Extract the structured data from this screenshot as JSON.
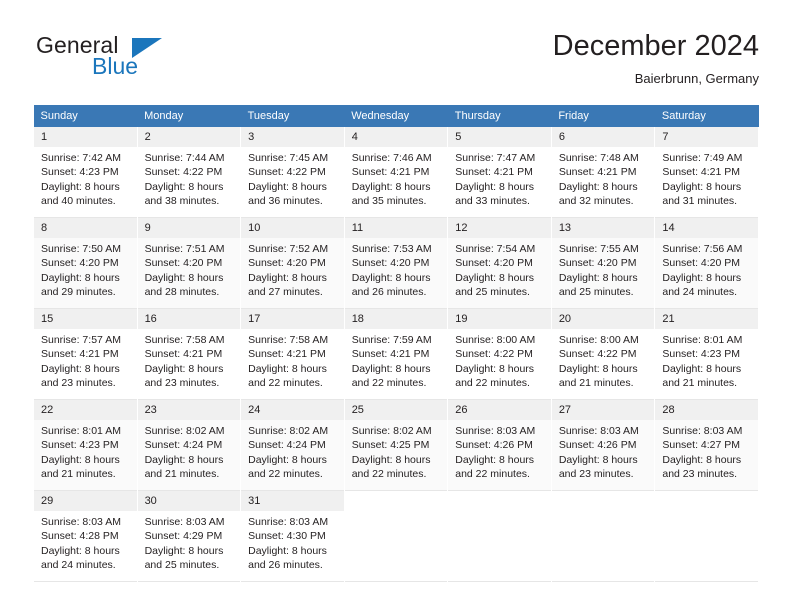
{
  "brand": {
    "name_part1": "General",
    "name_part2": "Blue",
    "triangle_color": "#1b76bc"
  },
  "header": {
    "title": "December 2024",
    "subtitle": "Baierbrunn, Germany",
    "header_bg": "#3a78b5",
    "daynum_bg": "#f0f0f0"
  },
  "calendar": {
    "weekday_headers": [
      "Sunday",
      "Monday",
      "Tuesday",
      "Wednesday",
      "Thursday",
      "Friday",
      "Saturday"
    ],
    "weeks": [
      [
        {
          "day": "1",
          "sunrise": "Sunrise: 7:42 AM",
          "sunset": "Sunset: 4:23 PM",
          "daylight1": "Daylight: 8 hours",
          "daylight2": "and 40 minutes."
        },
        {
          "day": "2",
          "sunrise": "Sunrise: 7:44 AM",
          "sunset": "Sunset: 4:22 PM",
          "daylight1": "Daylight: 8 hours",
          "daylight2": "and 38 minutes."
        },
        {
          "day": "3",
          "sunrise": "Sunrise: 7:45 AM",
          "sunset": "Sunset: 4:22 PM",
          "daylight1": "Daylight: 8 hours",
          "daylight2": "and 36 minutes."
        },
        {
          "day": "4",
          "sunrise": "Sunrise: 7:46 AM",
          "sunset": "Sunset: 4:21 PM",
          "daylight1": "Daylight: 8 hours",
          "daylight2": "and 35 minutes."
        },
        {
          "day": "5",
          "sunrise": "Sunrise: 7:47 AM",
          "sunset": "Sunset: 4:21 PM",
          "daylight1": "Daylight: 8 hours",
          "daylight2": "and 33 minutes."
        },
        {
          "day": "6",
          "sunrise": "Sunrise: 7:48 AM",
          "sunset": "Sunset: 4:21 PM",
          "daylight1": "Daylight: 8 hours",
          "daylight2": "and 32 minutes."
        },
        {
          "day": "7",
          "sunrise": "Sunrise: 7:49 AM",
          "sunset": "Sunset: 4:21 PM",
          "daylight1": "Daylight: 8 hours",
          "daylight2": "and 31 minutes."
        }
      ],
      [
        {
          "day": "8",
          "sunrise": "Sunrise: 7:50 AM",
          "sunset": "Sunset: 4:20 PM",
          "daylight1": "Daylight: 8 hours",
          "daylight2": "and 29 minutes."
        },
        {
          "day": "9",
          "sunrise": "Sunrise: 7:51 AM",
          "sunset": "Sunset: 4:20 PM",
          "daylight1": "Daylight: 8 hours",
          "daylight2": "and 28 minutes."
        },
        {
          "day": "10",
          "sunrise": "Sunrise: 7:52 AM",
          "sunset": "Sunset: 4:20 PM",
          "daylight1": "Daylight: 8 hours",
          "daylight2": "and 27 minutes."
        },
        {
          "day": "11",
          "sunrise": "Sunrise: 7:53 AM",
          "sunset": "Sunset: 4:20 PM",
          "daylight1": "Daylight: 8 hours",
          "daylight2": "and 26 minutes."
        },
        {
          "day": "12",
          "sunrise": "Sunrise: 7:54 AM",
          "sunset": "Sunset: 4:20 PM",
          "daylight1": "Daylight: 8 hours",
          "daylight2": "and 25 minutes."
        },
        {
          "day": "13",
          "sunrise": "Sunrise: 7:55 AM",
          "sunset": "Sunset: 4:20 PM",
          "daylight1": "Daylight: 8 hours",
          "daylight2": "and 25 minutes."
        },
        {
          "day": "14",
          "sunrise": "Sunrise: 7:56 AM",
          "sunset": "Sunset: 4:20 PM",
          "daylight1": "Daylight: 8 hours",
          "daylight2": "and 24 minutes."
        }
      ],
      [
        {
          "day": "15",
          "sunrise": "Sunrise: 7:57 AM",
          "sunset": "Sunset: 4:21 PM",
          "daylight1": "Daylight: 8 hours",
          "daylight2": "and 23 minutes."
        },
        {
          "day": "16",
          "sunrise": "Sunrise: 7:58 AM",
          "sunset": "Sunset: 4:21 PM",
          "daylight1": "Daylight: 8 hours",
          "daylight2": "and 23 minutes."
        },
        {
          "day": "17",
          "sunrise": "Sunrise: 7:58 AM",
          "sunset": "Sunset: 4:21 PM",
          "daylight1": "Daylight: 8 hours",
          "daylight2": "and 22 minutes."
        },
        {
          "day": "18",
          "sunrise": "Sunrise: 7:59 AM",
          "sunset": "Sunset: 4:21 PM",
          "daylight1": "Daylight: 8 hours",
          "daylight2": "and 22 minutes."
        },
        {
          "day": "19",
          "sunrise": "Sunrise: 8:00 AM",
          "sunset": "Sunset: 4:22 PM",
          "daylight1": "Daylight: 8 hours",
          "daylight2": "and 22 minutes."
        },
        {
          "day": "20",
          "sunrise": "Sunrise: 8:00 AM",
          "sunset": "Sunset: 4:22 PM",
          "daylight1": "Daylight: 8 hours",
          "daylight2": "and 21 minutes."
        },
        {
          "day": "21",
          "sunrise": "Sunrise: 8:01 AM",
          "sunset": "Sunset: 4:23 PM",
          "daylight1": "Daylight: 8 hours",
          "daylight2": "and 21 minutes."
        }
      ],
      [
        {
          "day": "22",
          "sunrise": "Sunrise: 8:01 AM",
          "sunset": "Sunset: 4:23 PM",
          "daylight1": "Daylight: 8 hours",
          "daylight2": "and 21 minutes."
        },
        {
          "day": "23",
          "sunrise": "Sunrise: 8:02 AM",
          "sunset": "Sunset: 4:24 PM",
          "daylight1": "Daylight: 8 hours",
          "daylight2": "and 21 minutes."
        },
        {
          "day": "24",
          "sunrise": "Sunrise: 8:02 AM",
          "sunset": "Sunset: 4:24 PM",
          "daylight1": "Daylight: 8 hours",
          "daylight2": "and 22 minutes."
        },
        {
          "day": "25",
          "sunrise": "Sunrise: 8:02 AM",
          "sunset": "Sunset: 4:25 PM",
          "daylight1": "Daylight: 8 hours",
          "daylight2": "and 22 minutes."
        },
        {
          "day": "26",
          "sunrise": "Sunrise: 8:03 AM",
          "sunset": "Sunset: 4:26 PM",
          "daylight1": "Daylight: 8 hours",
          "daylight2": "and 22 minutes."
        },
        {
          "day": "27",
          "sunrise": "Sunrise: 8:03 AM",
          "sunset": "Sunset: 4:26 PM",
          "daylight1": "Daylight: 8 hours",
          "daylight2": "and 23 minutes."
        },
        {
          "day": "28",
          "sunrise": "Sunrise: 8:03 AM",
          "sunset": "Sunset: 4:27 PM",
          "daylight1": "Daylight: 8 hours",
          "daylight2": "and 23 minutes."
        }
      ],
      [
        {
          "day": "29",
          "sunrise": "Sunrise: 8:03 AM",
          "sunset": "Sunset: 4:28 PM",
          "daylight1": "Daylight: 8 hours",
          "daylight2": "and 24 minutes."
        },
        {
          "day": "30",
          "sunrise": "Sunrise: 8:03 AM",
          "sunset": "Sunset: 4:29 PM",
          "daylight1": "Daylight: 8 hours",
          "daylight2": "and 25 minutes."
        },
        {
          "day": "31",
          "sunrise": "Sunrise: 8:03 AM",
          "sunset": "Sunset: 4:30 PM",
          "daylight1": "Daylight: 8 hours",
          "daylight2": "and 26 minutes."
        },
        {
          "day": "",
          "sunrise": "",
          "sunset": "",
          "daylight1": "",
          "daylight2": ""
        },
        {
          "day": "",
          "sunrise": "",
          "sunset": "",
          "daylight1": "",
          "daylight2": ""
        },
        {
          "day": "",
          "sunrise": "",
          "sunset": "",
          "daylight1": "",
          "daylight2": ""
        },
        {
          "day": "",
          "sunrise": "",
          "sunset": "",
          "daylight1": "",
          "daylight2": ""
        }
      ]
    ]
  }
}
